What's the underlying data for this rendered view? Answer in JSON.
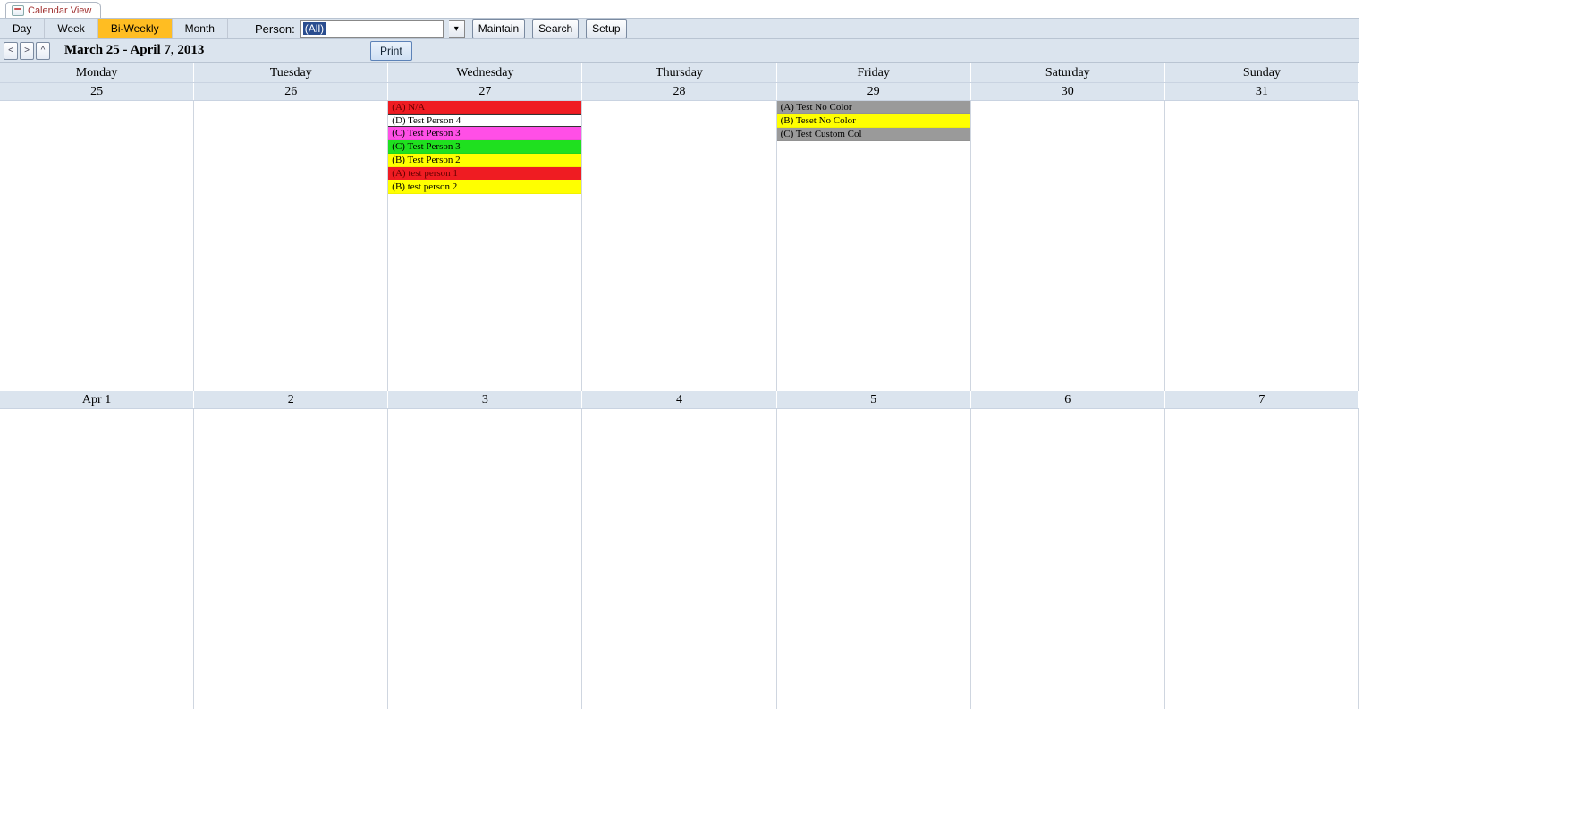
{
  "tab_title": "Calendar View",
  "views": {
    "day": "Day",
    "week": "Week",
    "biweekly": "Bi-Weekly",
    "month": "Month",
    "active": "biweekly"
  },
  "person": {
    "label": "Person:",
    "value": "(All)"
  },
  "toolbar": {
    "maintain": "Maintain",
    "search": "Search",
    "setup": "Setup",
    "print": "Print"
  },
  "nav": {
    "prev": "<",
    "next": ">",
    "up": "^"
  },
  "range_label": "March 25 - April 7, 2013",
  "weekdays": [
    "Monday",
    "Tuesday",
    "Wednesday",
    "Thursday",
    "Friday",
    "Saturday",
    "Sunday"
  ],
  "week1_dates": [
    "25",
    "26",
    "27",
    "28",
    "29",
    "30",
    "31"
  ],
  "week2_dates": [
    "Apr 1",
    "2",
    "3",
    "4",
    "5",
    "6",
    "7"
  ],
  "events": {
    "w1d2": [
      {
        "text": "(A) N/A",
        "color": "red"
      },
      {
        "text": "(D) Test Person 4",
        "color": "white"
      },
      {
        "text": "(C) Test Person 3",
        "color": "magenta"
      },
      {
        "text": "(C) Test Person 3",
        "color": "green"
      },
      {
        "text": "(B) Test Person 2",
        "color": "yellow"
      },
      {
        "text": "(A) test person 1",
        "color": "red"
      },
      {
        "text": "(B) test person 2",
        "color": "yellow"
      }
    ],
    "w1d4": [
      {
        "text": "(A) Test No Color",
        "color": "gray"
      },
      {
        "text": "(B) Teset No Color",
        "color": "yellow"
      },
      {
        "text": "(C) Test Custom Col",
        "color": "gray"
      }
    ]
  },
  "colors": {
    "red": "#ef1c22",
    "white": "#ffffff",
    "magenta": "#ff4fe6",
    "green": "#1fe01f",
    "yellow": "#ffff00",
    "gray": "#9a9a9a"
  }
}
